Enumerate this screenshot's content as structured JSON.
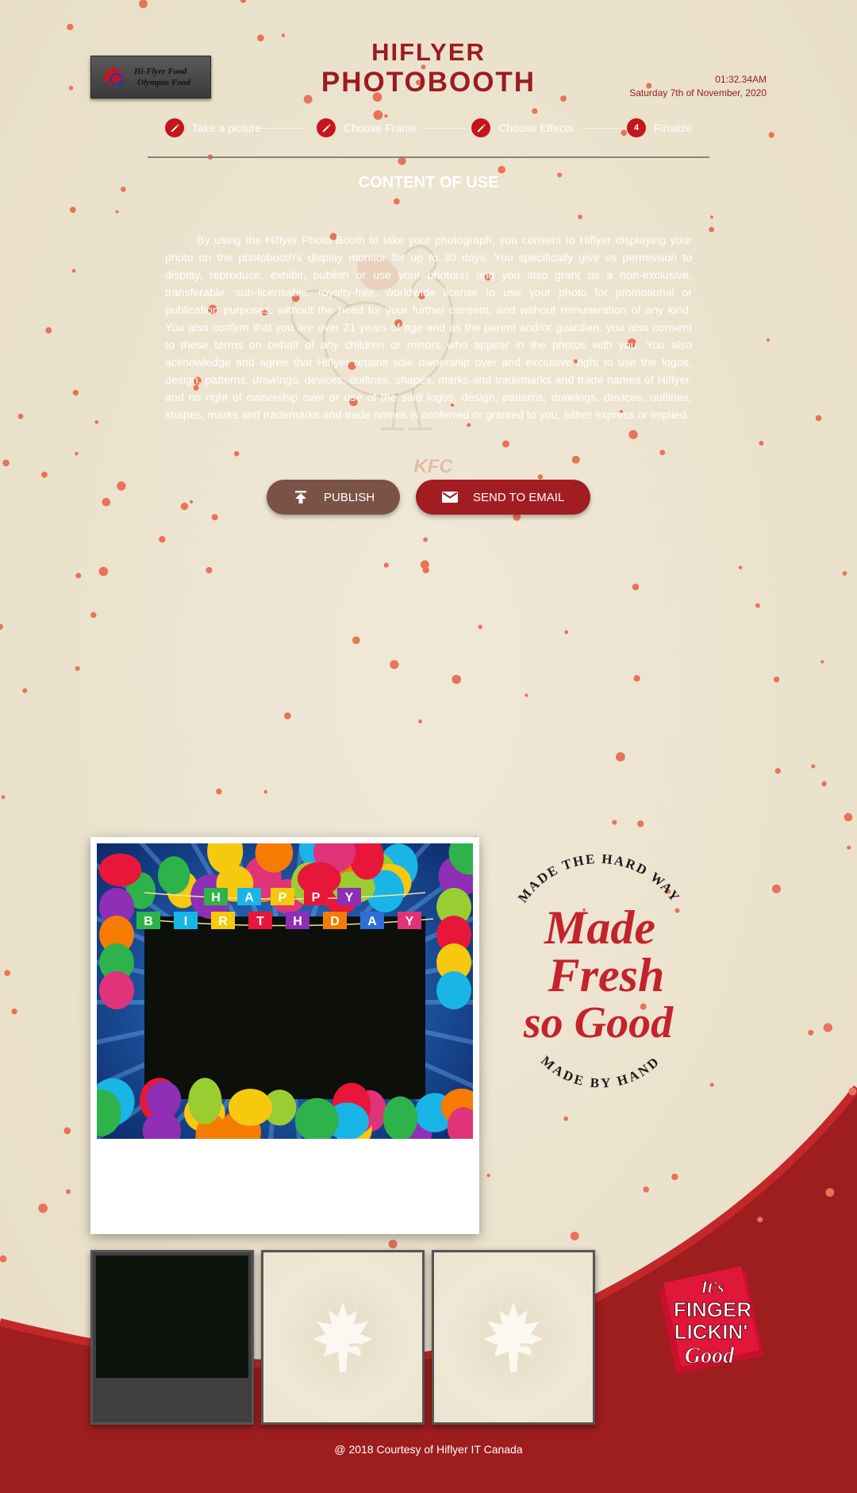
{
  "app": {
    "logo_text_line1": "Hi-Flyer Food",
    "logo_text_line2": "Olympus Food",
    "title_line1": "HIFLYER",
    "title_line2": "PHOTOBOOTH"
  },
  "clock": {
    "time": "01:32.34AM",
    "date": "Saturday 7th of November, 2020"
  },
  "stepper": {
    "steps": [
      {
        "label": "Take a picture",
        "icon": "pencil-icon"
      },
      {
        "label": "Choose Frame",
        "icon": "pencil-icon"
      },
      {
        "label": "Choose Effects",
        "icon": "pencil-icon"
      },
      {
        "label": "Finalize",
        "number": "4"
      }
    ]
  },
  "content": {
    "section_title": "CONTENT OF USE",
    "terms": "By using the Hiflyer Photo Booth to take your photograph, you consent to Hiflyer displaying your photo on the photobooth's display monitor for up to 30 days. You specifically give us permission to display, reproduce, exhibit, publish or use your photo(s) and you also grant us a non-exclusive, transferable, sub-licensable, royalty-free, worldwide license to use your photo for promotional or publication purposes, without the need for your further consent, and without remuneration of any kind. You also confirm that you are over 21 years of age and as the parent and/or guardian, you also consent to these terms on behalf of any children or minors who appear in the photos with you. You also acknowledge and agree that Hiflyer retains sole ownership over and exclusive right to use the logos, design, patterns, drawings, devices, outlines, shapes, marks and trademarks and trade names of Hiflyer, and no right of ownership over or use of the said logos, design, patterns, drawings, devices, outlines, shapes, marks and trademarks and trade names is conferred or granted to you, either express or implied.",
    "watermark": "KFC"
  },
  "actions": {
    "publish_label": "PUBLISH",
    "email_label": "SEND TO EMAIL"
  },
  "preview": {
    "banner_top": [
      "H",
      "A",
      "P",
      "P",
      "Y"
    ],
    "banner_bottom": [
      "B",
      "I",
      "R",
      "T",
      "H",
      "D",
      "A",
      "Y"
    ]
  },
  "badge": {
    "arc_top": "MADE THE HARD WAY",
    "line1": "Made",
    "line2": "Fresh",
    "line3": "so Good",
    "arc_bottom": "MADE BY HAND"
  },
  "finger_badge": {
    "line1": "It's",
    "line2": "FINGER",
    "line3": "LICKIN'",
    "line4": "Good"
  },
  "footer": {
    "text": "@ 2018 Courtesy of Hiflyer IT Canada"
  },
  "colors": {
    "brand_red": "#9b1c20",
    "step_red": "#c4161c",
    "background_cream": "#ece4cf",
    "publish_brown": "#7a5346"
  }
}
